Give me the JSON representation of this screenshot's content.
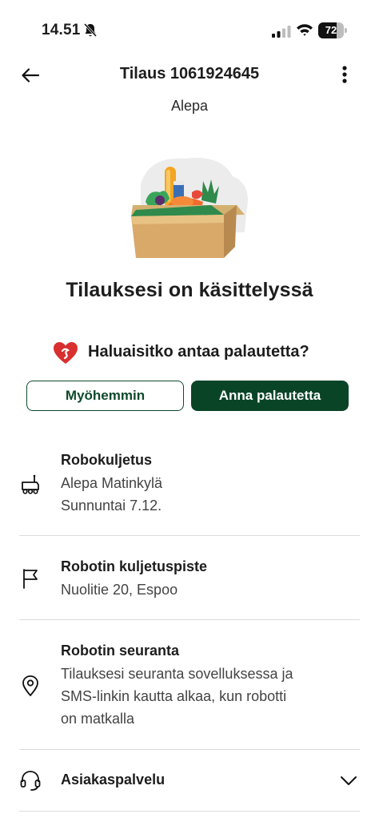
{
  "status_bar": {
    "time": "14.51",
    "battery_level": "72",
    "battery_fraction": 0.72
  },
  "header": {
    "title": "Tilaus 1061924645",
    "store": "Alepa"
  },
  "order_status": {
    "heading": "Tilauksesi on käsittelyssä"
  },
  "feedback": {
    "question": "Haluaisitko antaa palautetta?",
    "later_label": "Myöhemmin",
    "give_label": "Anna palautetta"
  },
  "delivery": {
    "title": "Robokuljetus",
    "lines": [
      "Alepa Matinkylä",
      "Sunnuntai 7.12."
    ]
  },
  "pickup_point": {
    "title": "Robotin kuljetuspiste",
    "address": "Nuolitie 20, Espoo"
  },
  "tracking": {
    "title": "Robotin seuranta",
    "lines": [
      "Tilauksesi seuranta sovelluksessa ja",
      "SMS-linkin kautta alkaa, kun robotti",
      "on matkalla"
    ]
  },
  "customer_service": {
    "label": "Asiakaspalvelu"
  },
  "colors": {
    "primary_green": "#0a4427",
    "heart_red": "#d8302f",
    "divider": "#dcdcdc"
  },
  "icons": [
    "bell-off-icon",
    "signal-icon",
    "wifi-icon",
    "back-arrow-icon",
    "more-vertical-icon",
    "heart-logo-icon",
    "robot-icon",
    "flag-icon",
    "location-pin-icon",
    "headset-icon",
    "chevron-down-icon"
  ]
}
